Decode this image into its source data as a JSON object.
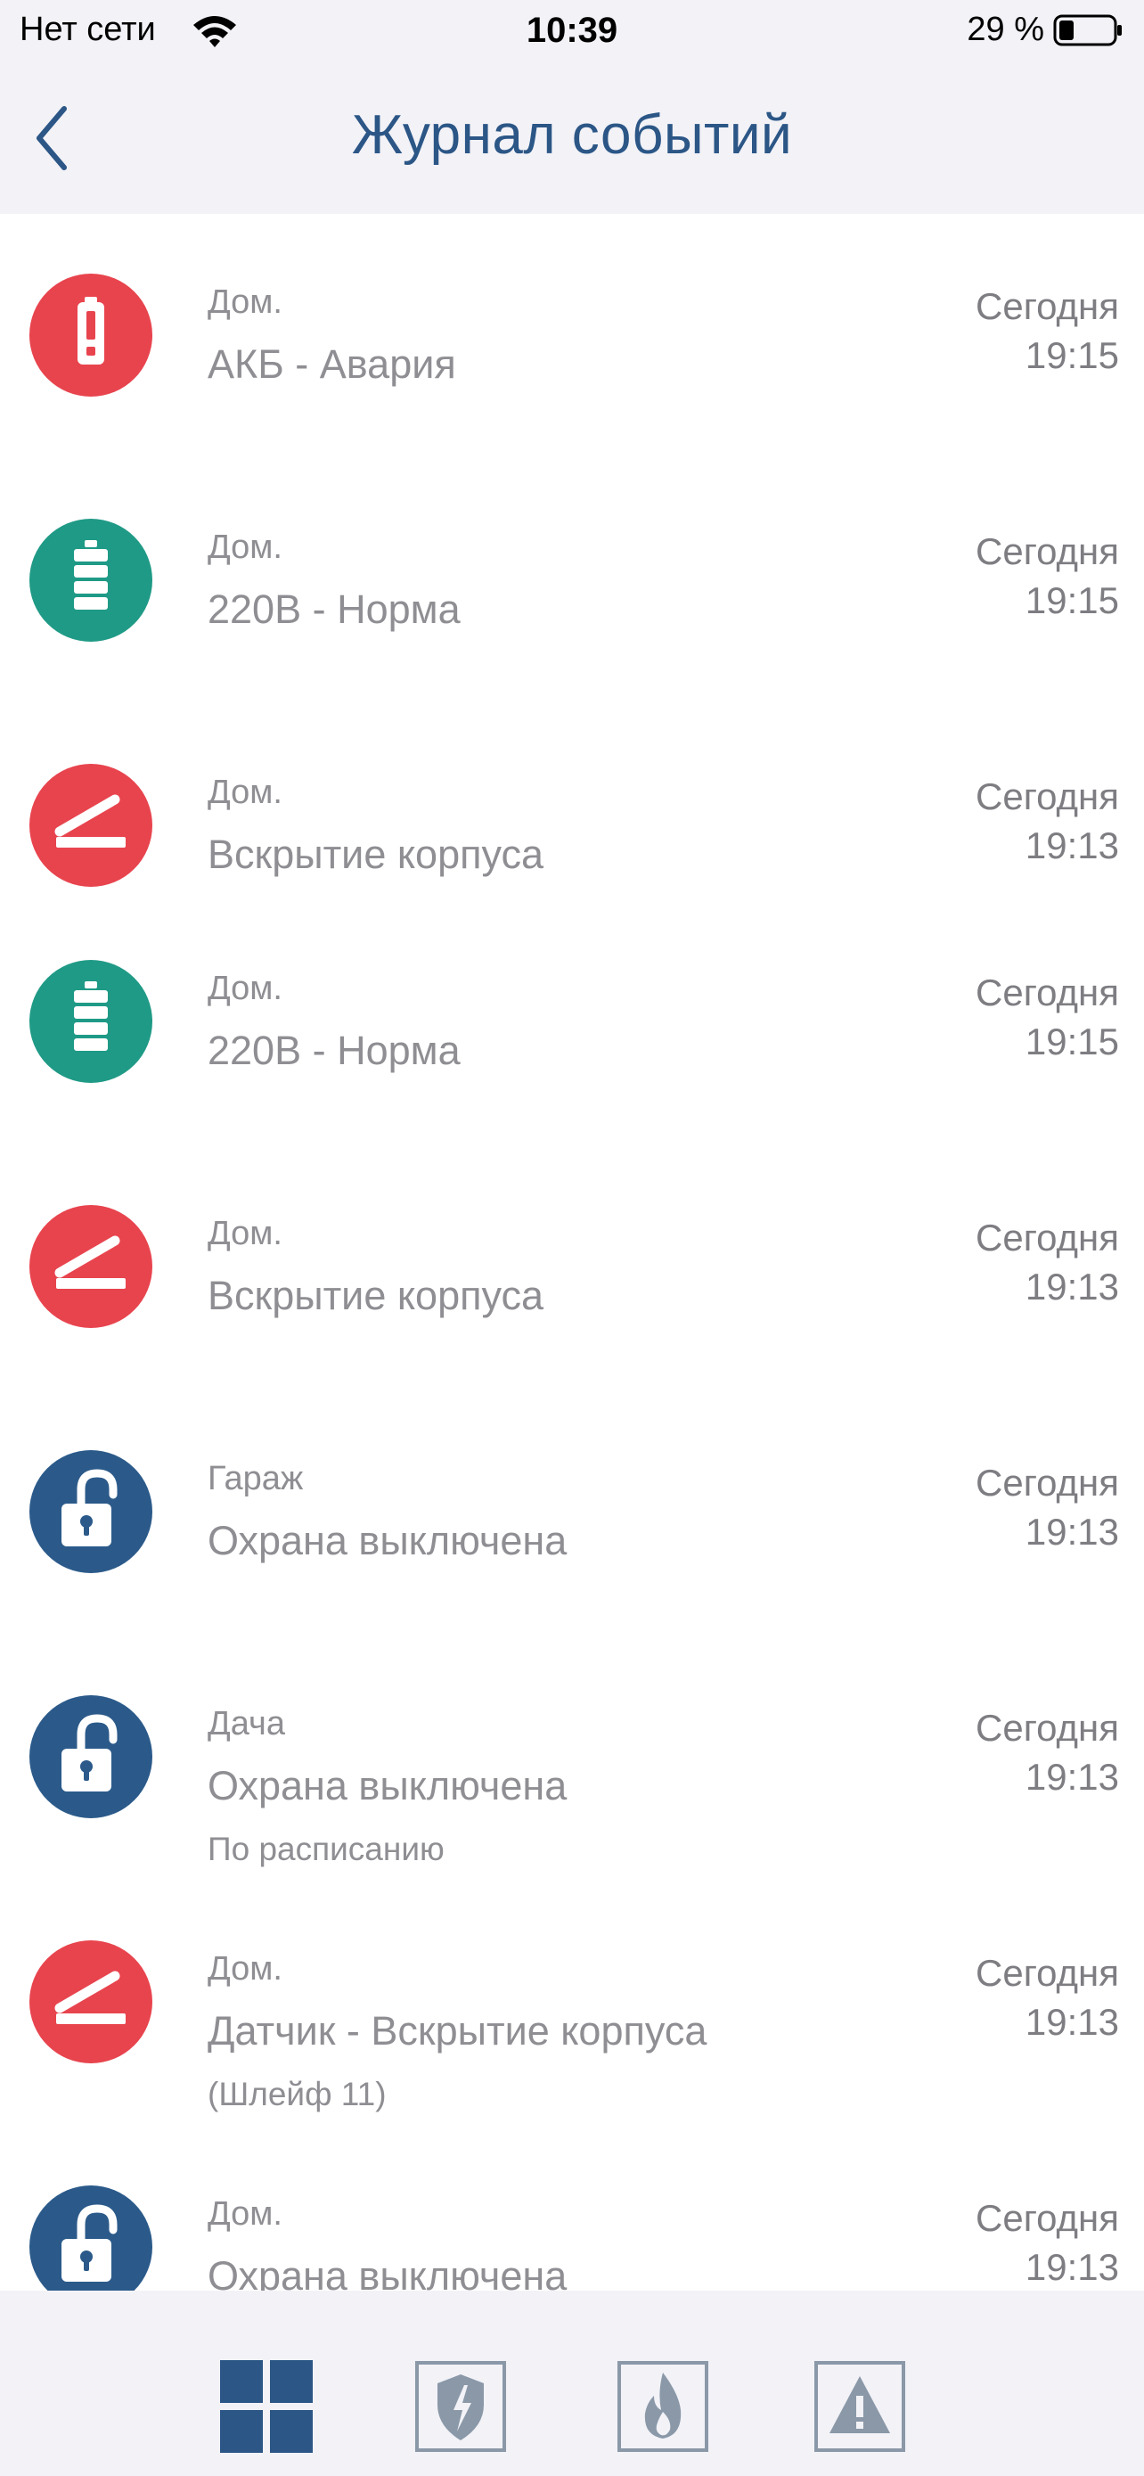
{
  "status_bar": {
    "carrier": "Нет сети",
    "time": "10:39",
    "battery": "29 %"
  },
  "nav": {
    "title": "Журнал событий",
    "back_icon": "chevron-left-icon"
  },
  "colors": {
    "alarm": "#e8444e",
    "normal": "#1f9a86",
    "disarm": "#2b5a8a",
    "title": "#2b5686",
    "text_secondary": "#8e8e93",
    "tab_active": "#2b5686",
    "tab_inactive": "#8a98a8"
  },
  "events": [
    {
      "icon": "battery-alert-icon",
      "status": "alarm",
      "object": "Дом.",
      "name": "АКБ - Авария",
      "extra": "",
      "date": "Сегодня",
      "time": "19:15"
    },
    {
      "icon": "battery-full-icon",
      "status": "normal",
      "object": "Дом.",
      "name": "220В - Норма",
      "extra": "",
      "date": "Сегодня",
      "time": "19:15"
    },
    {
      "icon": "tamper-icon",
      "status": "alarm",
      "object": "Дом.",
      "name": "Вскрытие корпуса",
      "extra": "",
      "date": "Сегодня",
      "time": "19:13"
    },
    {
      "icon": "battery-full-icon",
      "status": "normal",
      "object": "Дом.",
      "name": "220В - Норма",
      "extra": "",
      "date": "Сегодня",
      "time": "19:15"
    },
    {
      "icon": "tamper-icon",
      "status": "alarm",
      "object": "Дом.",
      "name": "Вскрытие корпуса",
      "extra": "",
      "date": "Сегодня",
      "time": "19:13"
    },
    {
      "icon": "unlock-icon",
      "status": "disarm",
      "object": "Гараж",
      "name": "Охрана выключена",
      "extra": "",
      "date": "Сегодня",
      "time": "19:13"
    },
    {
      "icon": "unlock-icon",
      "status": "disarm",
      "object": "Дача",
      "name": "Охрана выключена",
      "extra": "По расписанию",
      "date": "Сегодня",
      "time": "19:13"
    },
    {
      "icon": "tamper-icon",
      "status": "alarm",
      "object": "Дом.",
      "name": "Датчик - Вскрытие корпуса",
      "extra": "(Шлейф 11)",
      "date": "Сегодня",
      "time": "19:13"
    },
    {
      "icon": "unlock-icon",
      "status": "disarm",
      "object": "Дом.",
      "name": "Охрана выключена",
      "extra": "",
      "date": "Сегодня",
      "time": "19:13"
    }
  ],
  "tabs": [
    {
      "icon": "grid-icon",
      "active": true
    },
    {
      "icon": "shield-icon",
      "active": false
    },
    {
      "icon": "fire-icon",
      "active": false
    },
    {
      "icon": "warning-icon",
      "active": false
    }
  ]
}
